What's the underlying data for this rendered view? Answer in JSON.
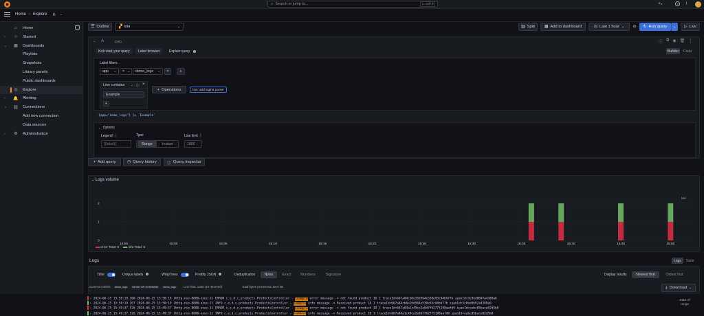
{
  "topbar": {
    "search_placeholder": "Search or jump to...",
    "search_shortcut": "ctrl+k",
    "plus_label": "+"
  },
  "breadcrumb": {
    "home": "Home",
    "separator": "›",
    "current": "Explore"
  },
  "toolbar": {
    "outline_label": "Outline",
    "datasource": "loki",
    "split_label": "Split",
    "add_to_dashboard_label": "Add to dashboard",
    "time_range": "Last 1 hour",
    "run_query_label": "Run query",
    "live_label": "Live"
  },
  "sidebar": {
    "items": [
      {
        "label": "Home",
        "icon": "home-icon",
        "chevron": ""
      },
      {
        "label": "Starred",
        "icon": "star-icon",
        "chevron": "›"
      },
      {
        "label": "Dashboards",
        "icon": "dashboards-icon",
        "chevron": "⌄"
      },
      {
        "label": "Playlists",
        "icon": "",
        "chevron": ""
      },
      {
        "label": "Snapshots",
        "icon": "",
        "chevron": ""
      },
      {
        "label": "Library panels",
        "icon": "",
        "chevron": ""
      },
      {
        "label": "Public dashboards",
        "icon": "",
        "chevron": ""
      },
      {
        "label": "Explore",
        "icon": "compass-icon",
        "chevron": "",
        "active": true
      },
      {
        "label": "Alerting",
        "icon": "bell-icon",
        "chevron": "›"
      },
      {
        "label": "Connections",
        "icon": "connections-icon",
        "chevron": "⌄"
      },
      {
        "label": "Add new connection",
        "icon": "",
        "chevron": ""
      },
      {
        "label": "Data sources",
        "icon": "",
        "chevron": ""
      },
      {
        "label": "Administration",
        "icon": "gear-icon",
        "chevron": "›"
      }
    ]
  },
  "query": {
    "ref_id": "A",
    "datasource_tag": "(loki)",
    "kick_start_label": "Kick start your query",
    "label_browser_label": "Label browser",
    "explain_label": "Explain query",
    "builder_label": "Builder",
    "code_label": "Code",
    "label_filters_title": "Label filters",
    "filter_key": "app",
    "filter_op": "=",
    "filter_value": "demo_logs",
    "line_filter": "Line contains",
    "line_filter_value": "Example",
    "operations_label": "Operations",
    "hint_label": "hint: add logfmt parser",
    "preview": "{app=\"demo_logs\"} |= `Example`",
    "options_label": "Options",
    "legend_label": "Legend",
    "legend_placeholder": "{{label}}",
    "type_label": "Type",
    "type_range": "Range",
    "type_instant": "Instant",
    "line_limit_label": "Line limit",
    "line_limit_value": "1000"
  },
  "actions": {
    "add_query": "Add query",
    "query_history": "Query history",
    "query_inspector": "Query inspector"
  },
  "logs_volume": {
    "title": "Logs volume",
    "legend_error": "error",
    "legend_error_total": "Total: 5",
    "legend_info": "info",
    "legend_info_total": "Total: 5",
    "right_label": "loki",
    "colors": {
      "error": "#e02f44",
      "info": "#73bf69"
    }
  },
  "chart_data": {
    "type": "bar",
    "title": "Logs volume",
    "y_ticks": [
      "2",
      "1",
      "0"
    ],
    "ylim": [
      0,
      2
    ],
    "x_ticks": [
      "14:55",
      "15:00",
      "15:05",
      "15:10",
      "15:15",
      "15:20",
      "15:25",
      "15:30",
      "15:35",
      "15:40",
      "15:45",
      "15:50"
    ],
    "series": [
      {
        "name": "error",
        "x": [
          "15:36",
          "15:39",
          "15:45",
          "15:50"
        ],
        "values": [
          1,
          1,
          1,
          1
        ]
      },
      {
        "name": "info",
        "x": [
          "15:36",
          "15:39",
          "15:45",
          "15:50"
        ],
        "values": [
          1,
          1,
          1,
          1
        ]
      }
    ]
  },
  "logs": {
    "title": "Logs",
    "tab_logs": "Logs",
    "tab_table": "Table",
    "time_label": "Time",
    "unique_labels_label": "Unique labels",
    "wrap_lines_label": "Wrap lines",
    "prettify_label": "Prettify JSON",
    "dedup_label": "Deduplication",
    "dedup_none": "None",
    "dedup_exact": "Exact",
    "dedup_numbers": "Numbers",
    "dedup_signature": "Signature",
    "display_results_label": "Display results",
    "newest_first": "Newest first",
    "oldest_first": "Oldest first",
    "common_labels_label": "Common labels:",
    "common_label_1": "demo_logs",
    "common_label_2": "DESKTOP-3LSMMDH",
    "common_label_3": "demo_logs",
    "line_limit": "Line limit: 1000 (10 returned)",
    "bytes_processed": "Total bytes processed: 98.5 kB",
    "download_label": "Download",
    "start_of_range": "Start of range",
    "lines": [
      {
        "pre": "2024-06-25 15:50:19.308 2024-06-25 15:50:19 [http-nio-8080-exec-2] ERROR c.e.d.c.products.ProductsController - ",
        "match": "Example",
        "post": " error message -> not found product ID 1 traceId=667a84cb6e26d564e530e93c04b677b spanId=3c8ed0697a4389a6",
        "level": "error"
      },
      {
        "pre": "2024-06-25 15:50:19.307 2024-06-25 15:50:19 [http-nio-8080-exec-2] INFO  c.e.d.c.products.ProductsController - ",
        "match": "Example",
        "post": " info  message -> Received product ID 1 traceId=667a84cb6e26d564e530e93c04b677b spanId=3c8ed0697a4389a6",
        "level": "info"
      },
      {
        "pre": "2024-06-25 15:49:37.526 2024-06-25 15:49:37 [http-nio-8080-exec-1] ERROR c.e.d.c.products.ProductsController - ",
        "match": "Example",
        "post": " error message -> not found product ID 1 traceId=667a84a1c49ce2e0d7f62775198aafd9 spanId=eebc85bace02d5b8",
        "level": "error"
      },
      {
        "pre": "2024-06-25 15:49:37.526 2024-06-25 15:49:37 [http-nio-8080-exec-1] INFO  c.e.d.c.products.ProductsController - ",
        "match": "Example",
        "post": " info  message -> Received product ID 1 traceId=667a84a1c49ce2e0d7f62775198aafd9 spanId=eebc85bace02d5b8",
        "level": "info"
      }
    ]
  }
}
